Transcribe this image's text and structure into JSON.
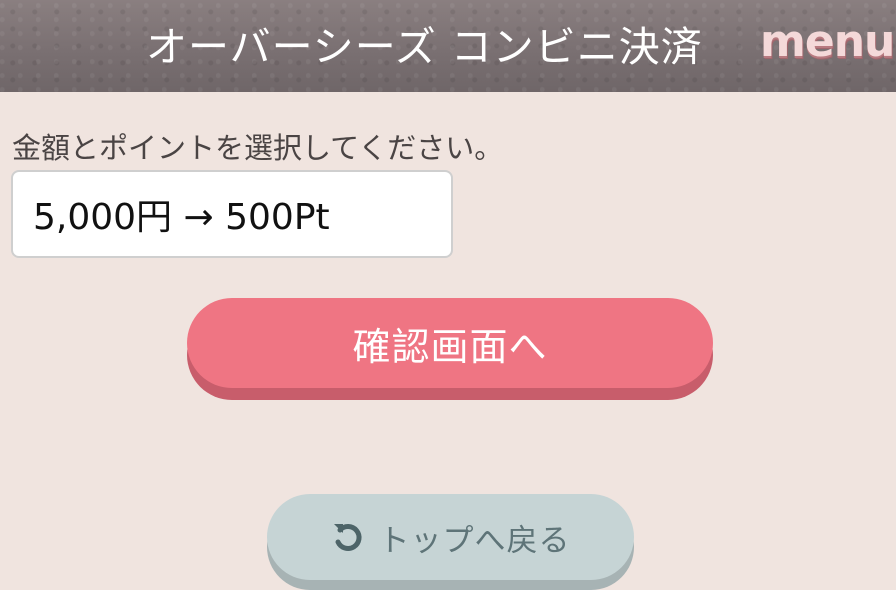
{
  "header": {
    "title": "オーバーシーズ コンビニ決済",
    "menu_label": "menu"
  },
  "form": {
    "instruction": "金額とポイントを選択してください。",
    "selected_option": "5,000円 → 500Pt"
  },
  "buttons": {
    "confirm_label": "確認画面へ",
    "back_to_top_label": "トップへ戻る",
    "back_to_top_icon": "undo-icon"
  },
  "colors": {
    "page_background": "#f0e4df",
    "confirm_button": "#ef7583",
    "back_button": "#c6d4d5",
    "menu_text": "#f4d9d9"
  }
}
